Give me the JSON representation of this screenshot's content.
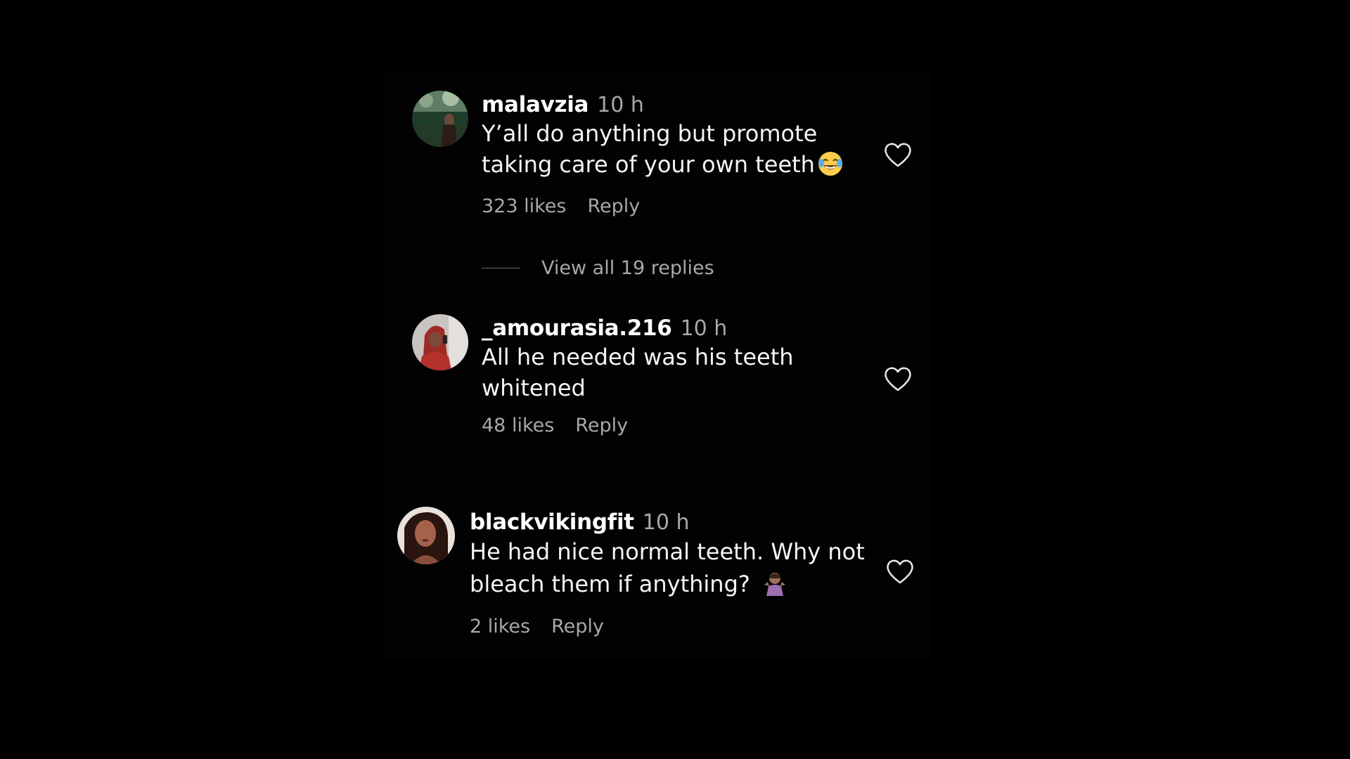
{
  "comments": [
    {
      "username": "malavzia",
      "time": "10 h",
      "lines": [
        "Y’all do anything but promote",
        "taking care of your own teeth"
      ],
      "emoji": "face-with-tears-of-joy",
      "likes": "323 likes",
      "reply_label": "Reply",
      "liked": false
    },
    {
      "username": "_amourasia.216",
      "time": "10 h",
      "lines": [
        "All he needed was his teeth",
        "whitened"
      ],
      "emoji": "",
      "likes": "48 likes",
      "reply_label": "Reply",
      "liked": false
    },
    {
      "username": "blackvikingfit",
      "time": "10 h",
      "lines": [
        "He had nice normal teeth. Why not",
        "bleach them if anything?"
      ],
      "emoji": "person-shrugging",
      "likes": "2 likes",
      "reply_label": "Reply",
      "liked": false
    }
  ],
  "view_replies": "View all 19 replies",
  "colors": {
    "background": "#000000",
    "primary_text": "#f5f5f5",
    "secondary_text": "#a8a8a8"
  },
  "icons": {
    "like": "heart-outline-icon"
  }
}
